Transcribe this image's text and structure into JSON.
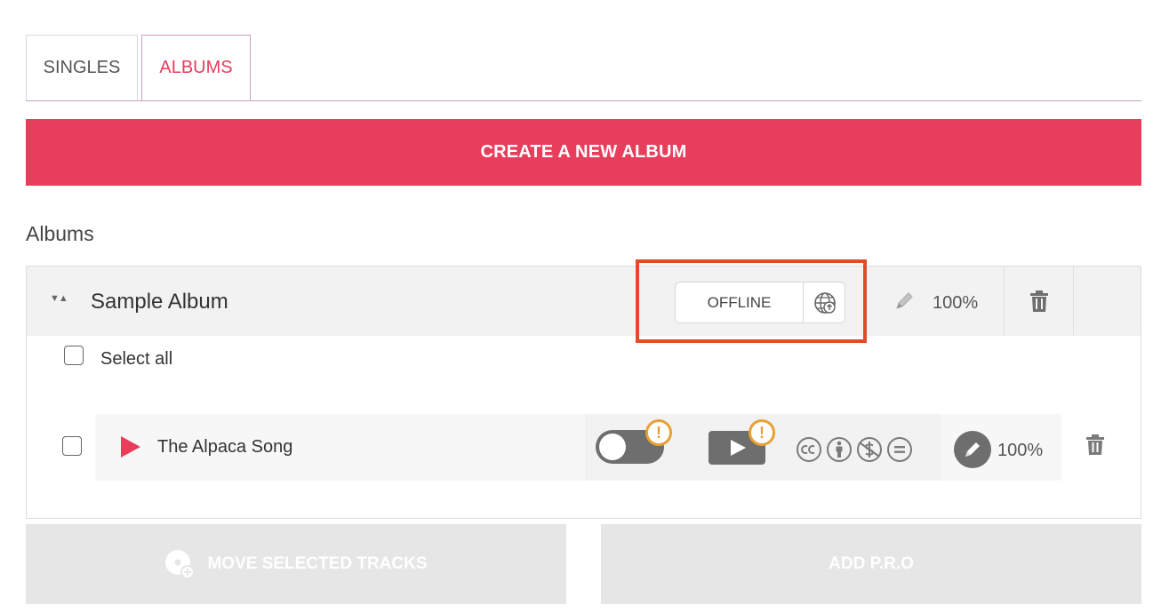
{
  "tabs": [
    {
      "label": "SINGLES",
      "active": false
    },
    {
      "label": "ALBUMS",
      "active": true
    }
  ],
  "create_album_label": "CREATE A NEW ALBUM",
  "albums_heading": "Albums",
  "album": {
    "sort_icon": "sort-arrows-icon",
    "title": "Sample Album",
    "status": "OFFLINE",
    "status_icon": "globe-upload-icon",
    "percent": "100%",
    "select_all_label": "Select all",
    "tracks": [
      {
        "title": "The Alpaca Song",
        "percent": "100%",
        "warning_glyph": "!",
        "license_icons": [
          "cc-icon",
          "attribution-icon",
          "non-commercial-icon",
          "no-derivatives-icon"
        ]
      }
    ]
  },
  "actions": {
    "move_label": "MOVE SELECTED TRACKS",
    "pro_label": "ADD P.R.O"
  },
  "colors": {
    "accent": "#e83e5c",
    "warning": "#e8a034",
    "highlight": "#e24a2a"
  }
}
